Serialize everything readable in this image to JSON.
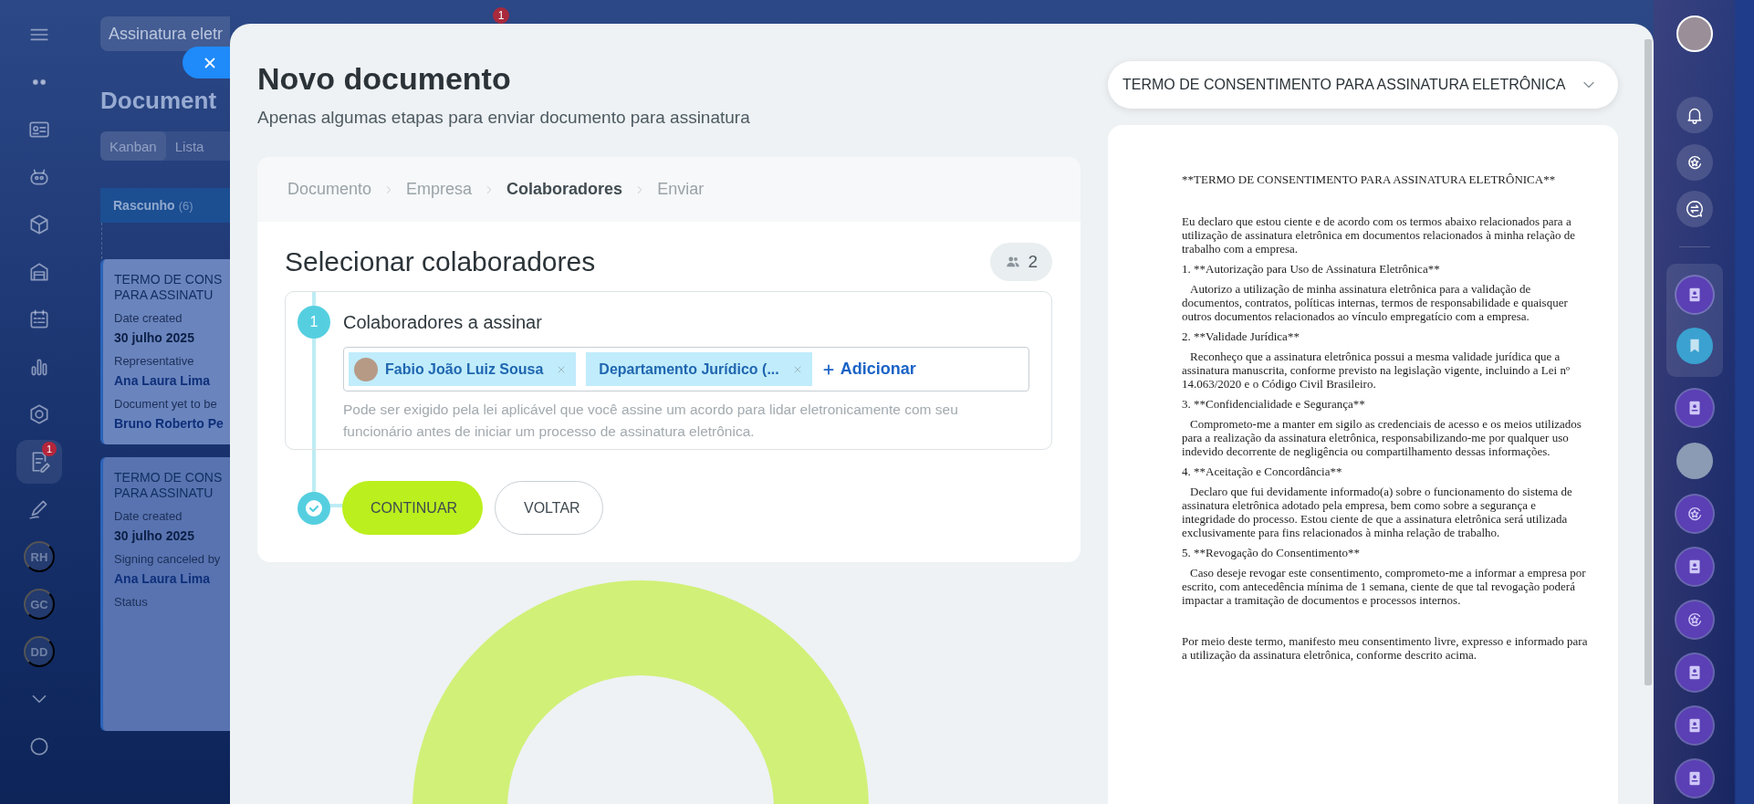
{
  "left_nav": {
    "items": [
      {
        "kind": "icon",
        "selected": false
      },
      {
        "kind": "icon",
        "selected": false
      },
      {
        "kind": "icon",
        "selected": false
      },
      {
        "kind": "icon",
        "selected": false
      },
      {
        "kind": "icon",
        "selected": false
      },
      {
        "kind": "icon",
        "selected": false
      },
      {
        "kind": "icon",
        "selected": false
      },
      {
        "kind": "icon",
        "selected": false
      },
      {
        "kind": "icon",
        "selected": false
      },
      {
        "kind": "icon",
        "selected": true,
        "badge": "1"
      },
      {
        "kind": "icon",
        "selected": false
      },
      {
        "kind": "initials",
        "label": "RH",
        "selected": false
      },
      {
        "kind": "initials",
        "label": "GC",
        "selected": false
      },
      {
        "kind": "initials",
        "label": "DD",
        "selected": false
      },
      {
        "kind": "icon",
        "selected": false
      },
      {
        "kind": "icon",
        "selected": false
      }
    ]
  },
  "workspace": {
    "search": {
      "value": "Assinatura eletr"
    },
    "notification_badge": "1",
    "title": "Document",
    "view_tabs": [
      {
        "label": "Kanban",
        "selected": true
      },
      {
        "label": "Lista",
        "selected": false
      }
    ],
    "column": {
      "title": "Rascunho",
      "count": "(6)"
    },
    "cards": [
      {
        "title_lines": [
          "TERMO DE CONS",
          "PARA ASSINATU"
        ],
        "fields": [
          {
            "label": "Date created",
            "value": "30 julho 2025",
            "kind": "date"
          },
          {
            "label": "Representative",
            "value": "Ana Laura Lima",
            "kind": "person"
          },
          {
            "label": "Document yet to be",
            "value": "Bruno Roberto Pe",
            "kind": "person"
          }
        ]
      },
      {
        "title_lines": [
          "TERMO DE CONS",
          "PARA ASSINATU"
        ],
        "fields": [
          {
            "label": "Date created",
            "value": "30 julho 2025",
            "kind": "date"
          },
          {
            "label": "Signing canceled by",
            "value": "Ana Laura Lima",
            "kind": "person"
          },
          {
            "label": "Status",
            "kind": "status"
          }
        ]
      }
    ]
  },
  "modal": {
    "title": "Novo documento",
    "subtitle": "Apenas algumas etapas para enviar documento para assinatura",
    "steps": [
      {
        "label": "Documento",
        "selected": false
      },
      {
        "label": "Empresa",
        "selected": false
      },
      {
        "label": "Colaboradores",
        "selected": true
      },
      {
        "label": "Enviar",
        "selected": false
      }
    ],
    "section_title": "Selecionar colaboradores",
    "member_count": "2",
    "signers": {
      "number": "1",
      "title": "Colaboradores a assinar",
      "tags": [
        {
          "kind": "user",
          "label": "Fabio João Luiz Sousa"
        },
        {
          "kind": "department",
          "label": "Departamento Jurídico (..."
        }
      ],
      "add_label": "Adicionar",
      "hint": "Pode ser exigido pela lei aplicável que você assine um acordo para lidar eletronicamente com seu funcionário antes de iniciar um processo de assinatura eletrônica."
    },
    "buttons": [
      {
        "kind": "primary",
        "label": "CONTINUAR"
      },
      {
        "kind": "secondary",
        "label": "VOLTAR"
      }
    ]
  },
  "document": {
    "selector": "TERMO DE CONSENTIMENTO PARA ASSINATURA ELETRÔNICA",
    "paragraphs": [
      {
        "kind": "title",
        "text": "**TERMO DE CONSENTIMENTO PARA ASSINATURA ELETRÔNICA**"
      },
      {
        "kind": "plain",
        "text": "Eu declaro que estou ciente e de acordo com os termos abaixo relacionados para a utilização de assinatura eletrônica em documentos relacionados à minha relação de trabalho com a empresa."
      },
      {
        "kind": "heading",
        "text": "1. **Autorização para Uso de Assinatura Eletrônica**"
      },
      {
        "kind": "body",
        "text": "Autorizo a utilização de minha assinatura eletrônica para a validação de documentos, contratos, políticas internas, termos de responsabilidade e quaisquer outros documentos relacionados ao vínculo empregatício com a empresa."
      },
      {
        "kind": "heading",
        "text": "2. **Validade Jurídica**"
      },
      {
        "kind": "body",
        "text": "Reconheço que a assinatura eletrônica possui a mesma validade jurídica que a assinatura manuscrita, conforme previsto na legislação vigente, incluindo a Lei nº 14.063/2020 e o Código Civil Brasileiro."
      },
      {
        "kind": "heading",
        "text": "3. **Confidencialidade e Segurança**"
      },
      {
        "kind": "body",
        "text": "Comprometo-me a manter em sigilo as credenciais de acesso e os meios utilizados para a realização da assinatura eletrônica, responsabilizando-me por qualquer uso indevido decorrente de negligência ou compartilhamento dessas informações."
      },
      {
        "kind": "heading",
        "text": "4. **Aceitação e Concordância**"
      },
      {
        "kind": "body",
        "text": "Declaro que fui devidamente informado(a) sobre o funcionamento do sistema de assinatura eletrônica adotado pela empresa, bem como sobre a segurança e integridade do processo. Estou ciente de que a assinatura eletrônica será utilizada exclusivamente para fins relacionados à minha relação de trabalho."
      },
      {
        "kind": "heading",
        "text": "5. **Revogação do Consentimento**"
      },
      {
        "kind": "body",
        "text": "Caso deseje revogar este consentimento, comprometo-me a informar a empresa por escrito, com antecedência mínima de 1 semana, ciente de que tal revogação poderá impactar a tramitação de documentos e processos internos."
      },
      {
        "kind": "closing",
        "text": "Por meio deste termo, manifesto meu consentimento livre, expresso e informado para a utilização da assinatura eletrônica, conforme descrito acima."
      }
    ]
  }
}
